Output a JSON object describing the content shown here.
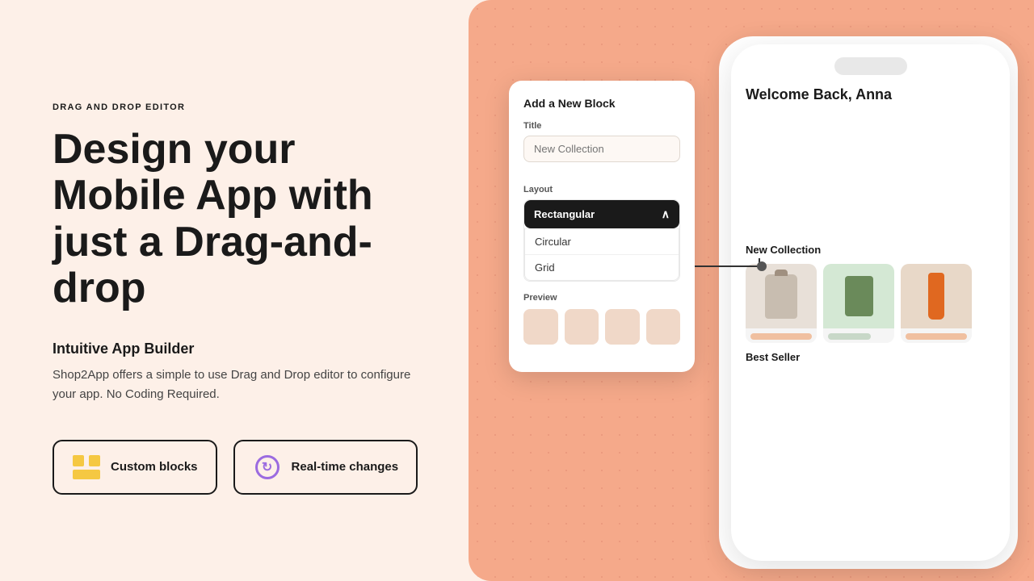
{
  "left": {
    "drag_label": "DRAG AND DROP EDITOR",
    "hero_title": "Design your Mobile App with just a Drag-and-drop",
    "subtitle": "Intuitive App Builder",
    "description": "Shop2App offers a simple to use Drag and Drop editor to configure your app. No Coding Required.",
    "btn_custom_blocks": "Custom blocks",
    "btn_realtime": "Real-time changes"
  },
  "modal": {
    "title": "Add a New Block",
    "title_label": "Title",
    "title_placeholder": "New Collection",
    "layout_label": "Layout",
    "layout_selected": "Rectangular",
    "layout_options": [
      "Circular",
      "Grid"
    ],
    "preview_label": "Preview"
  },
  "phone": {
    "greeting": "Back, Anna",
    "section1": "New Collection",
    "section2": "Best Seller"
  }
}
